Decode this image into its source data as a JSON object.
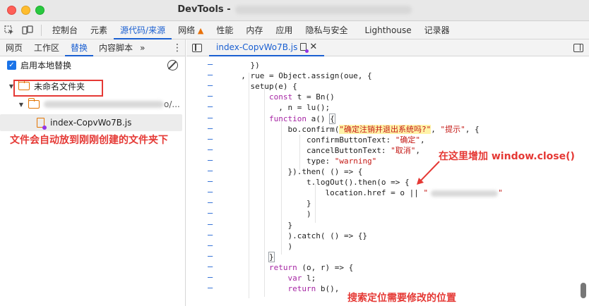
{
  "window": {
    "title": "DevTools -"
  },
  "panels": [
    {
      "label": "控制台",
      "active": false
    },
    {
      "label": "元素",
      "active": false
    },
    {
      "label": "源代码/来源",
      "active": true
    },
    {
      "label": "网络",
      "active": false,
      "warning": true
    },
    {
      "label": "性能",
      "active": false
    },
    {
      "label": "内存",
      "active": false
    },
    {
      "label": "应用",
      "active": false
    },
    {
      "label": "隐私与安全",
      "active": false
    },
    {
      "label": "Lighthouse",
      "active": false
    },
    {
      "label": "记录器",
      "active": false
    }
  ],
  "sidebar": {
    "tabs": [
      {
        "label": "网页",
        "active": false
      },
      {
        "label": "工作区",
        "active": false
      },
      {
        "label": "替换",
        "active": true
      },
      {
        "label": "内容脚本",
        "active": false
      }
    ],
    "more_label": "»",
    "enable_override_label": "启用本地替换",
    "tree": {
      "folder_label": "未命名文件夹",
      "subfolder_suffix": "o/...",
      "file_label": "index-CopvWo7B.js"
    }
  },
  "editor": {
    "tab_label": "index-CopvWo7B.js",
    "code_lines": [
      "    })",
      "  , rue = Object.assign(oue, {",
      "    setup(e) {",
      "        const t = Bn()",
      "          , n = lu();",
      "        function a() {",
      "            bo.confirm(\"确定注销并退出系统吗?\", \"提示\", {",
      "                confirmButtonText: \"确定\",",
      "                cancelButtonText: \"取消\",",
      "                type: \"warning\"",
      "            }).then( () => {",
      "                t.logOut().then(o => {",
      "                    location.href = o || \"",
      "                }",
      "                )",
      "            }",
      "            ).catch( () => {}",
      "            )",
      "        }",
      "        return (o, r) => {",
      "            var l;",
      "            return b(),"
    ]
  },
  "annotations": {
    "folder_note": "文件会自动放到刚刚创建的文件夹下",
    "add_note": "在这里增加 window.close()",
    "search_note": "搜索定位需要修改的位置"
  },
  "colors": {
    "accent": "#1a5fd1",
    "annotation": "#e53935",
    "keyword": "#a626a4",
    "string": "#c41a16",
    "folder": "#e37400"
  }
}
